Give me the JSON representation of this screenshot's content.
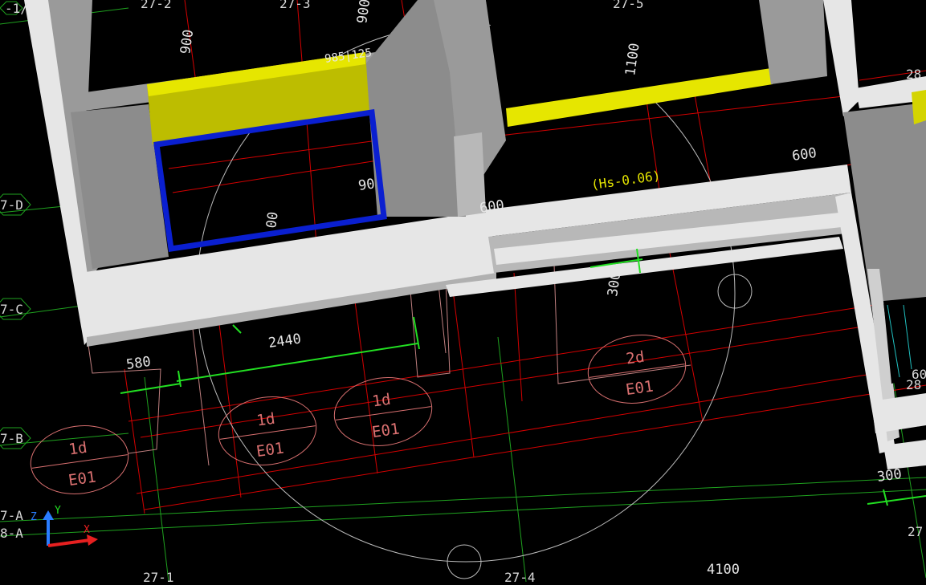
{
  "viewport": {
    "background": "#000000",
    "colors": {
      "wall": "#e6e6e6",
      "wall_dark": "#9a9a9a",
      "column": "#8c8c8c",
      "beam_yellow": "#bdbd00",
      "beam_yellow_top": "#e6e600",
      "opening_blue": "#0a1fd0",
      "red_lines": "#d40000",
      "grid_lines": "#1fa21f",
      "dim_lines": "#22e022",
      "tag_color": "#d97070",
      "elevation_text": "#e6e600"
    }
  },
  "grid_labels": {
    "row_top_1": "-1/",
    "col_27_2": "27-2",
    "col_27_3": "27-3",
    "col_27_5": "27-5",
    "row_28_top": "28",
    "row_27_D": "7-D",
    "row_27_C": "7-C",
    "row_27_B": "7-B",
    "row_27_A": "7-A",
    "row_28_A": "8-A",
    "col_27_1_bottom": "27-1",
    "col_27_4_bottom": "27-4",
    "col_27_right": "27",
    "right_edge_row_60": "60",
    "right_edge_row_28": "28"
  },
  "dimensions": {
    "d900_left": "900",
    "d900_top": "900",
    "d985_125": "985|125",
    "d1100": "1100",
    "d600_right": "600",
    "d600_mid": "600",
    "d90": "90",
    "d00": "00",
    "d300_mid": "300",
    "d2440": "2440",
    "d580": "580",
    "d300_right": "300",
    "d4100": "4100"
  },
  "elevation_note": "(Hs-0.06)",
  "room_tags": [
    {
      "top": "1d",
      "bottom": "E01"
    },
    {
      "top": "1d",
      "bottom": "E01"
    },
    {
      "top": "1d",
      "bottom": "E01"
    },
    {
      "top": "2d",
      "bottom": "E01"
    }
  ],
  "ucs_icon": {
    "z_label": "Z",
    "y_label": "Y",
    "x_label": "X"
  }
}
